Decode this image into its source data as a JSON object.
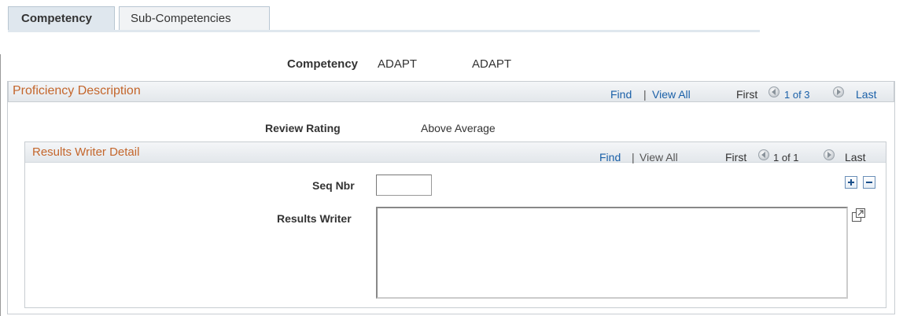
{
  "tabs": [
    {
      "label": "Competency",
      "active": true
    },
    {
      "label": "Sub-Competencies",
      "active": false
    }
  ],
  "header": {
    "competency_label": "Competency",
    "competency_value": "ADAPT",
    "competency_desc": "ADAPT"
  },
  "proficiency": {
    "title": "Proficiency Description",
    "find": "Find",
    "separator": "|",
    "view_all": "View All",
    "first": "First",
    "position": "1 of 3",
    "last": "Last",
    "review_rating_label": "Review Rating",
    "review_rating_value": "Above Average"
  },
  "results_writer": {
    "title": "Results Writer Detail",
    "find": "Find",
    "separator": "|",
    "view_all": "View All",
    "first": "First",
    "position": "1 of 1",
    "last": "Last",
    "seq_label": "Seq Nbr",
    "seq_value": "",
    "writer_label": "Results Writer",
    "writer_value": ""
  },
  "icons": {
    "prev": "prev-arrow-icon",
    "next": "next-arrow-icon",
    "add": "add-row-icon",
    "delete": "delete-row-icon",
    "expand": "expand-textarea-icon"
  },
  "colors": {
    "section_title": "#c4662c",
    "link": "#1a60a8",
    "tab_active_bg": "#dfe7ee"
  }
}
